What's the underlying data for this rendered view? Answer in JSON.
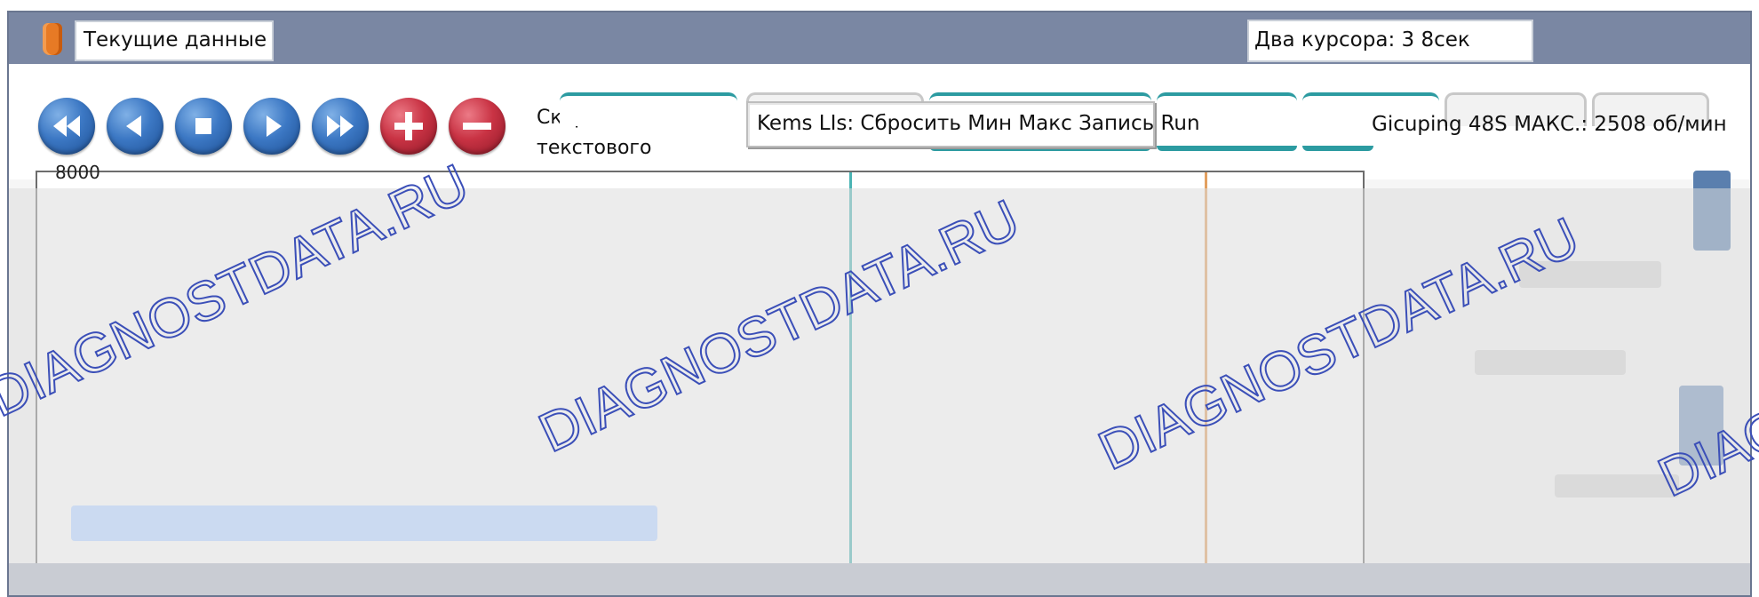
{
  "window": {
    "title": "Текущие данные",
    "cursor_info": "Два курсора: 3 8сек"
  },
  "toolbar": {
    "speed_label": "Скорость текстового движе...",
    "reset_label": "Kems LIs: Сбросить Мин Макс Запись Run",
    "max_label": "Gicuping 48S МАКС.: 2508 об/мин"
  },
  "graph": {
    "value_label": "8000"
  },
  "colors": {
    "titlebar": "#7a87a3",
    "accent_teal": "#2c9ba1",
    "button_blue": "#3c78c4",
    "button_red": "#c93344",
    "cursor_teal": "#4bb4b4",
    "cursor_orange": "#e3a060"
  },
  "watermark": {
    "text": "DIAGNOSTDATA.RU"
  }
}
